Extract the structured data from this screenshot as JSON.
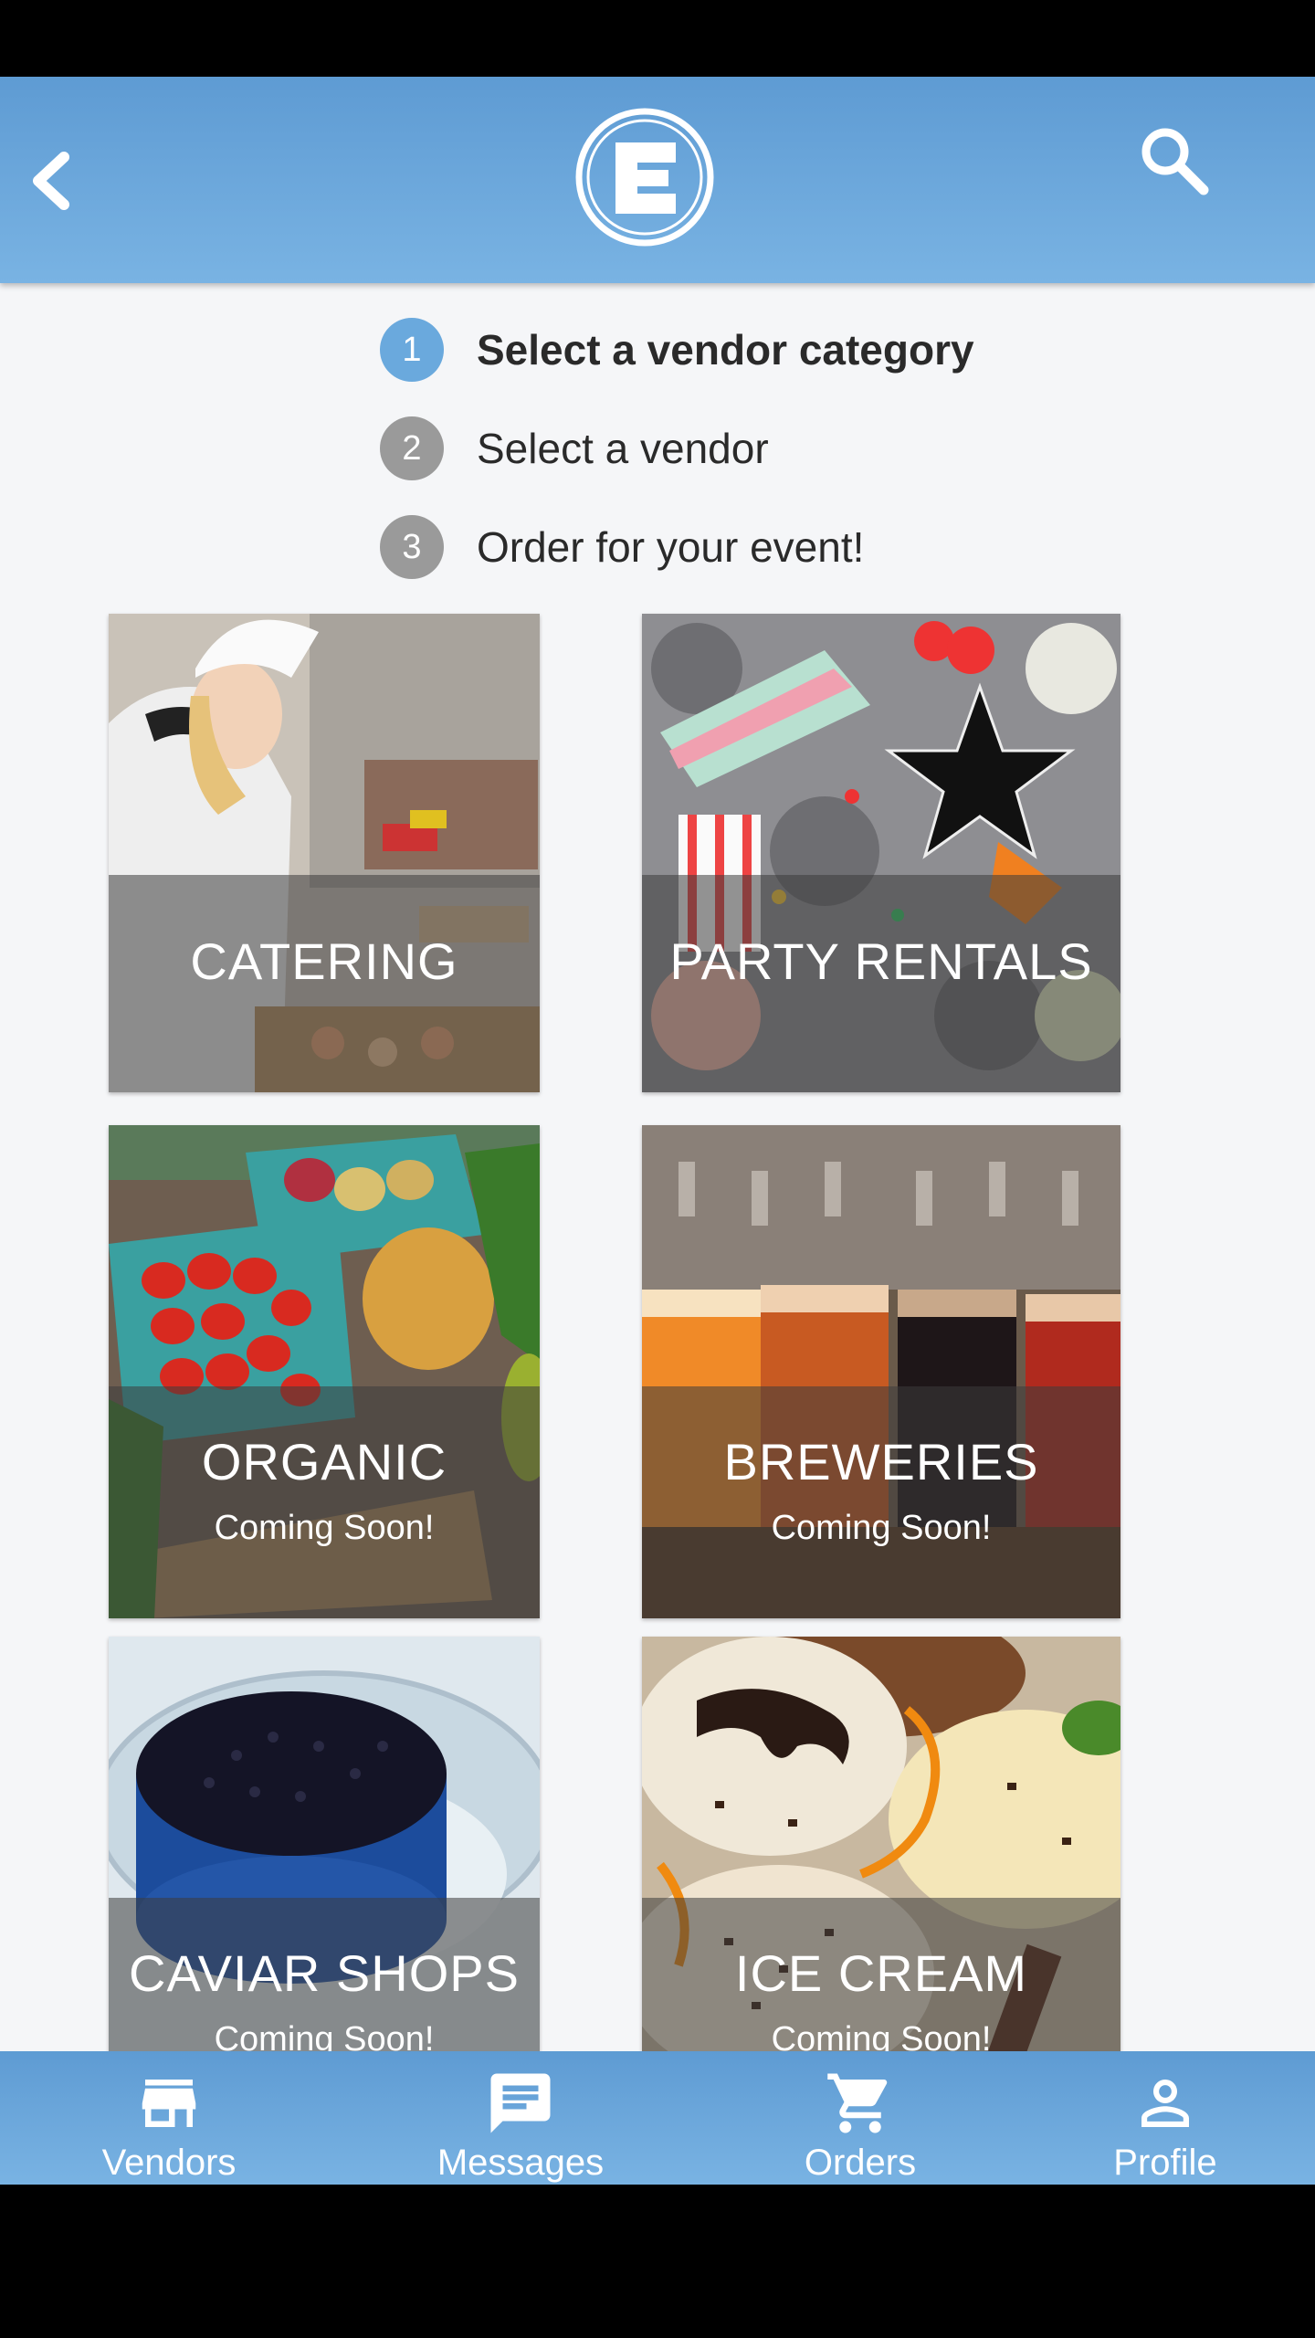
{
  "colors": {
    "accent": "#5e9bd3",
    "step_active": "#6aa9dd",
    "step_inactive": "#9a9a9a"
  },
  "header": {
    "back_icon": "chevron-left-icon",
    "logo_letter": "E",
    "search_icon": "search-icon"
  },
  "steps": [
    {
      "number": "1",
      "label": "Select a vendor category"
    },
    {
      "number": "2",
      "label": "Select a vendor"
    },
    {
      "number": "3",
      "label": "Order for your event!"
    }
  ],
  "categories": [
    {
      "title": "CATERING",
      "subtitle": ""
    },
    {
      "title": "PARTY RENTALS",
      "subtitle": ""
    },
    {
      "title": "ORGANIC",
      "subtitle": "Coming Soon!"
    },
    {
      "title": "BREWERIES",
      "subtitle": "Coming Soon!"
    },
    {
      "title": "CAVIAR SHOPS",
      "subtitle": "Coming Soon!"
    },
    {
      "title": "ICE CREAM",
      "subtitle": "Coming Soon!"
    }
  ],
  "bottom_nav": [
    {
      "label": "Vendors",
      "icon": "store-icon"
    },
    {
      "label": "Messages",
      "icon": "message-icon"
    },
    {
      "label": "Orders",
      "icon": "cart-icon"
    },
    {
      "label": "Profile",
      "icon": "person-icon"
    }
  ]
}
